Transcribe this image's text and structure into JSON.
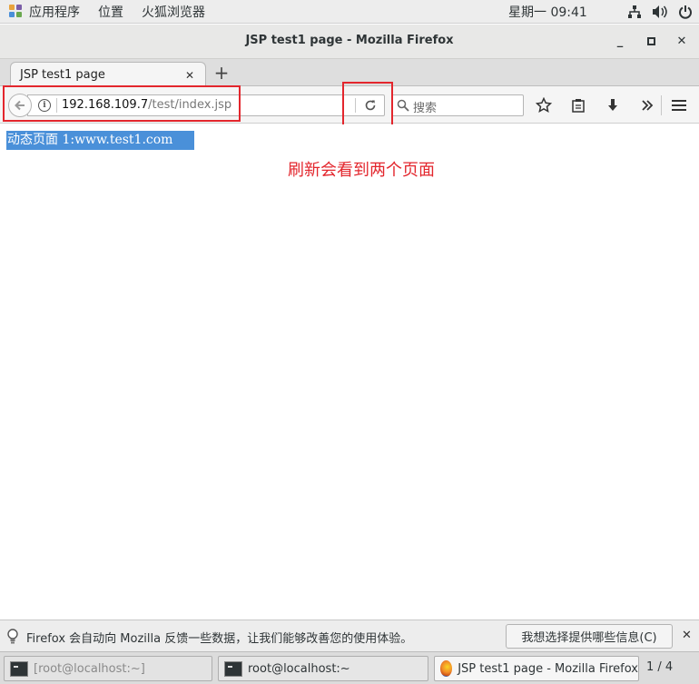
{
  "topbar": {
    "apps": "应用程序",
    "places": "位置",
    "firefox_app": "火狐浏览器",
    "clock": "星期一 09:41"
  },
  "window": {
    "title": "JSP test1 page - Mozilla Firefox",
    "minimize": "_",
    "maximize": "▫",
    "close": "✕"
  },
  "tabs": [
    {
      "label": "JSP test1 page",
      "close": "✕"
    }
  ],
  "newtab": "+",
  "navbar": {
    "url_host": "192.168.109.7",
    "url_path": "/test/index.jsp",
    "search_placeholder": "搜索",
    "info_glyph": "i"
  },
  "page": {
    "selected_text": "动态页面 1:www.test1.com",
    "annotation": "刷新会看到两个页面"
  },
  "notification": {
    "text": "Firefox 会自动向 Mozilla 反馈一些数据，让我们能够改善您的使用体验。",
    "button": "我想选择提供哪些信息(C)",
    "close": "✕"
  },
  "taskbar": {
    "items": [
      {
        "label": "[root@localhost:~]"
      },
      {
        "label": "root@localhost:~"
      },
      {
        "label": "JSP test1 page - Mozilla Firefox"
      }
    ],
    "pager": "1 / 4"
  },
  "colors": {
    "annotation_red": "#e3262d",
    "selection_blue": "#4a90d9"
  }
}
